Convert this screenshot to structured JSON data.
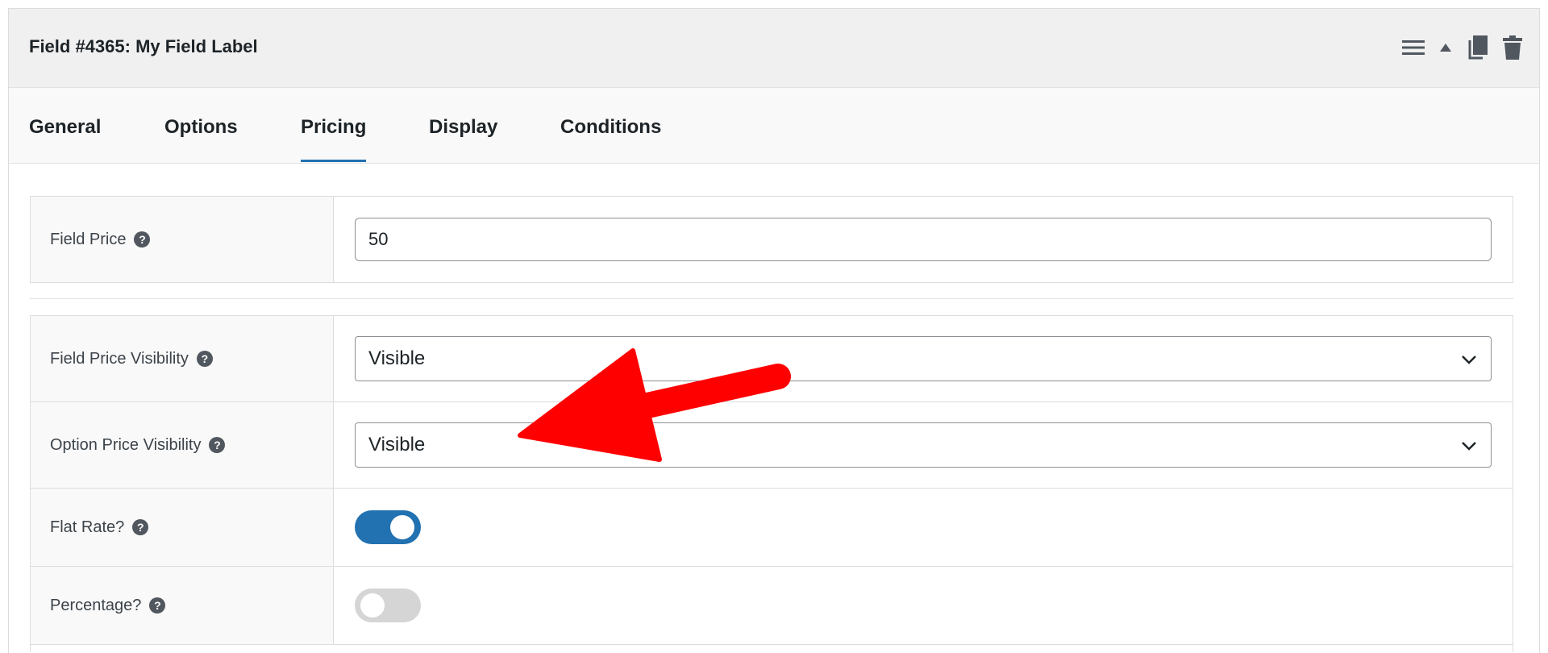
{
  "header": {
    "title": "Field #4365: My Field Label"
  },
  "tabs": [
    {
      "label": "General",
      "active": false
    },
    {
      "label": "Options",
      "active": false
    },
    {
      "label": "Pricing",
      "active": true
    },
    {
      "label": "Display",
      "active": false
    },
    {
      "label": "Conditions",
      "active": false
    }
  ],
  "rows": {
    "field_price": {
      "label": "Field Price",
      "value": "50"
    },
    "field_price_visibility": {
      "label": "Field Price Visibility",
      "selected": "Visible"
    },
    "option_price_visibility": {
      "label": "Option Price Visibility",
      "selected": "Visible"
    },
    "flat_rate": {
      "label": "Flat Rate?",
      "enabled": true
    },
    "percentage": {
      "label": "Percentage?",
      "enabled": false
    }
  },
  "help_glyph": "?",
  "colors": {
    "accent": "#2271b1",
    "toggle_off": "#d5d5d5",
    "annotation_arrow": "#ff0000"
  },
  "icons": [
    "menu-icon",
    "collapse-up-icon",
    "duplicate-icon",
    "trash-icon",
    "help-icon",
    "chevron-down-icon"
  ]
}
